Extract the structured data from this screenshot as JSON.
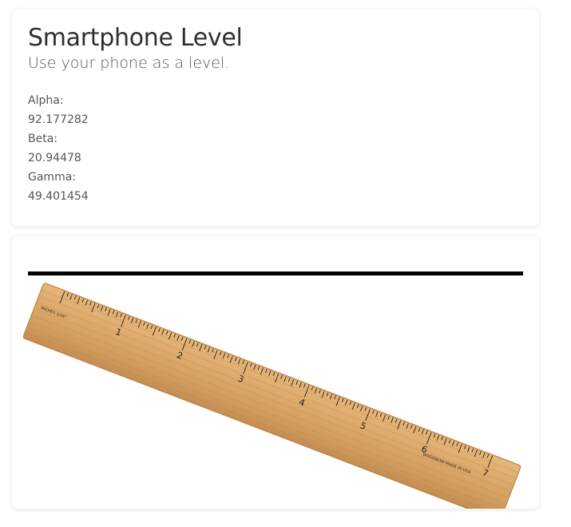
{
  "header": {
    "title": "Smartphone Level",
    "subtitle": "Use your phone as a level."
  },
  "readings": {
    "alpha_label": "Alpha:",
    "alpha_value": "92.177282",
    "beta_label": "Beta:",
    "beta_value": "20.94478",
    "gamma_label": "Gamma:",
    "gamma_value": "49.401454"
  },
  "ruler": {
    "inch_labels": [
      "1",
      "2",
      "3",
      "4",
      "5",
      "6",
      "7"
    ],
    "left_mark": "INCHES 1/16\"",
    "right_mark": "WOODBOW MADE IN USA",
    "wood_color": "#d9a86a",
    "edge_color": "#b07b3e"
  },
  "colors": {
    "level_line": "#000000",
    "text": "#555555",
    "title": "#2f2f2f"
  }
}
